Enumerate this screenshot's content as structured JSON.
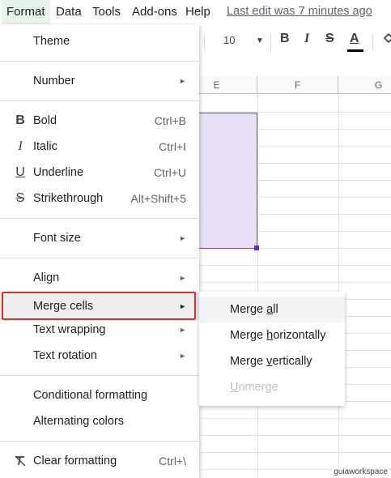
{
  "menubar": {
    "items": [
      {
        "label": "Format"
      },
      {
        "label": "Data"
      },
      {
        "label": "Tools"
      },
      {
        "label": "Add-ons"
      },
      {
        "label": "Help"
      }
    ],
    "last_edit": "Last edit was 7 minutes ago"
  },
  "toolbar": {
    "font_size": "10",
    "bold_glyph": "B",
    "italic_glyph": "I",
    "strike_glyph": "S",
    "text_color_glyph": "A"
  },
  "grid": {
    "columns": [
      "E",
      "F",
      "G"
    ]
  },
  "format_menu": {
    "theme": "Theme",
    "number": "Number",
    "bold": {
      "label": "Bold",
      "shortcut": "Ctrl+B"
    },
    "italic": {
      "label": "Italic",
      "shortcut": "Ctrl+I"
    },
    "underline": {
      "label": "Underline",
      "shortcut": "Ctrl+U"
    },
    "strikethrough": {
      "label": "Strikethrough",
      "shortcut": "Alt+Shift+5"
    },
    "font_size": "Font size",
    "align": "Align",
    "merge_cells": "Merge cells",
    "text_wrapping": "Text wrapping",
    "text_rotation": "Text rotation",
    "conditional_formatting": "Conditional formatting",
    "alternating_colors": "Alternating colors",
    "clear_formatting": {
      "label": "Clear formatting",
      "shortcut": "Ctrl+\\"
    },
    "arrow_glyph": "►"
  },
  "merge_submenu": {
    "merge_all": {
      "pre": "Merge ",
      "key": "a",
      "post": "ll"
    },
    "merge_horizontally": {
      "pre": "Merge ",
      "key": "h",
      "post": "orizontally"
    },
    "merge_vertically": {
      "pre": "Merge ",
      "key": "v",
      "post": "ertically"
    },
    "unmerge": {
      "pre": "",
      "key": "U",
      "post": "nmerge"
    }
  },
  "watermark": "guiaworkspace",
  "colors": {
    "highlight_box": "#d93025",
    "selection_fill": "#e8e0f7",
    "selection_border": "#8e44ad",
    "menubar_active": "#e6f4ea"
  }
}
